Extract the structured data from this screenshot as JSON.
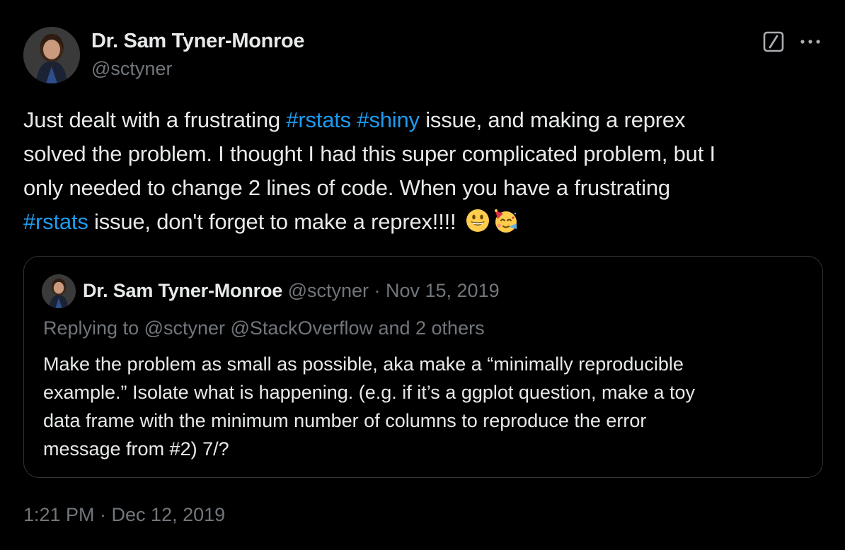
{
  "author": {
    "name": "Dr. Sam Tyner-Monroe",
    "handle": "@sctyner"
  },
  "header_icons": {
    "grok": "grok-slash-icon",
    "more": "more-dots-icon"
  },
  "tweet": {
    "lines": [
      [
        {
          "text": "Just dealt with a frustrating ",
          "type": "text"
        },
        {
          "text": "#rstats",
          "type": "hashtag"
        },
        {
          "text": " ",
          "type": "text"
        },
        {
          "text": "#shiny",
          "type": "hashtag"
        },
        {
          "text": " issue, and making a reprex",
          "type": "text"
        }
      ],
      [
        {
          "text": "solved the problem. I thought I had this super complicated problem, but I",
          "type": "text"
        }
      ],
      [
        {
          "text": "only needed to change 2 lines of code. When you have a frustrating",
          "type": "text"
        }
      ],
      [
        {
          "text": "#rstats",
          "type": "hashtag"
        },
        {
          "text": " issue, don't forget to make a reprex!!!! ",
          "type": "text"
        }
      ]
    ],
    "emojis": [
      "grinning-face-icon",
      "partying-face-icon"
    ],
    "timestamp": "1:21 PM · Dec 12, 2019"
  },
  "quoted": {
    "name": "Dr. Sam Tyner-Monroe",
    "meta": " @sctyner · Nov 15, 2019",
    "replying": "Replying to @sctyner @StackOverflow and 2 others",
    "lines": [
      "Make the problem as small as possible, aka make a “minimally reproducible",
      "example.” Isolate what is happening. (e.g. if it’s a ggplot question, make a toy",
      "data frame with the minimum number of columns to reproduce the error",
      "message from #2) 7/?"
    ]
  },
  "colors": {
    "background": "#000000",
    "text": "#e7e9ea",
    "secondary": "#71767b",
    "link": "#1d9bf0",
    "border": "#2f3336"
  }
}
